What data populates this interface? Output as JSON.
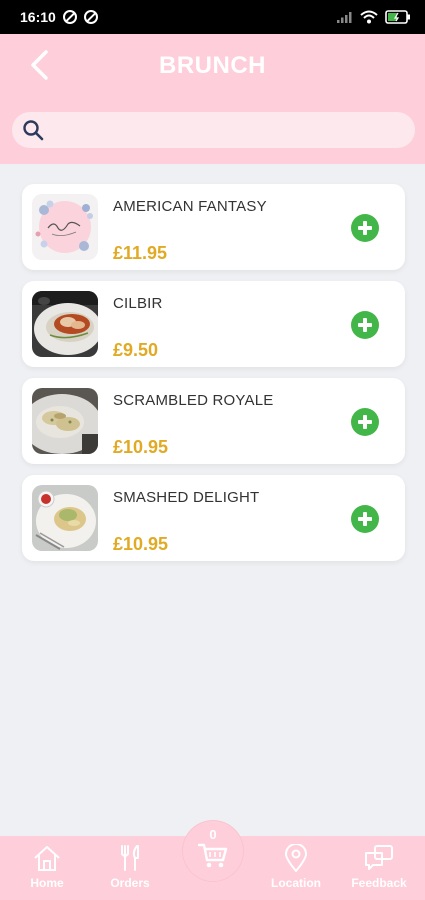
{
  "status_bar": {
    "time": "16:10"
  },
  "header": {
    "title": "BRUNCH"
  },
  "search": {
    "placeholder": "",
    "value": ""
  },
  "menu_items": [
    {
      "name": "AMERICAN FANTASY",
      "price": "£11.95",
      "image": "blu-ivy-logo"
    },
    {
      "name": "CILBIR",
      "price": "£9.50",
      "image": "cilbir-dish-photo"
    },
    {
      "name": "SCRAMBLED ROYALE",
      "price": "£10.95",
      "image": "scrambled-royale-dish-photo"
    },
    {
      "name": "SMASHED DELIGHT",
      "price": "£10.95",
      "image": "smashed-delight-dish-photo"
    }
  ],
  "bottom_nav": {
    "home": "Home",
    "orders": "Orders",
    "cart_count": "0",
    "location": "Location",
    "feedback": "Feedback"
  },
  "colors": {
    "header_bg": "#fecfda",
    "price": "#e1aa24",
    "add_button": "#43b649",
    "page_bg": "#eef0f3"
  }
}
